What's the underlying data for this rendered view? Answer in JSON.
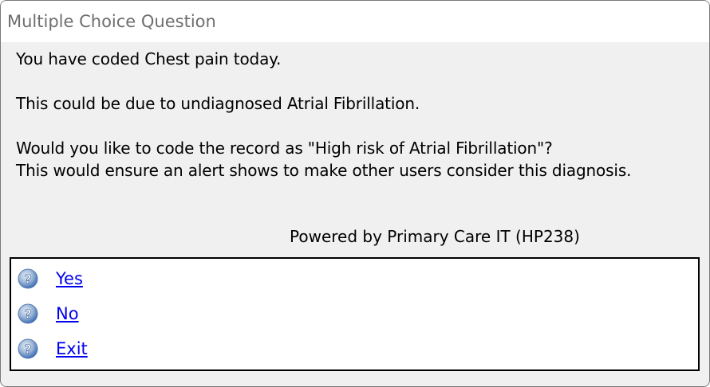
{
  "window": {
    "title": "Multiple Choice Question"
  },
  "message": {
    "line1": "You have coded Chest pain today.",
    "line2": "This could be due to undiagnosed Atrial Fibrillation.",
    "line3": "Would you like to code the record as \"High risk of Atrial Fibrillation\"?",
    "line4": "This would ensure an alert shows to make other users consider this diagnosis."
  },
  "powered_by": "Powered by Primary Care IT (HP238)",
  "options": [
    {
      "label": "Yes",
      "icon": "help-question-icon"
    },
    {
      "label": "No",
      "icon": "help-question-icon"
    },
    {
      "label": "Exit",
      "icon": "help-question-icon"
    }
  ],
  "colors": {
    "link": "#0000ee",
    "icon_blue": "#3d6fb6",
    "dialog_bg": "#f0f0f0"
  }
}
